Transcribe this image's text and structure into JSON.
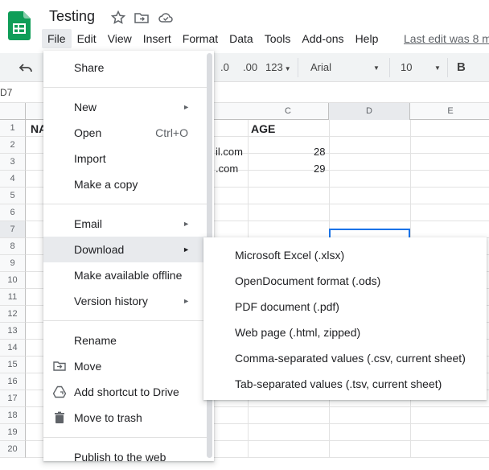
{
  "header": {
    "title": "Testing",
    "last_edit": "Last edit was 8 m",
    "menus": [
      "File",
      "Edit",
      "View",
      "Insert",
      "Format",
      "Data",
      "Tools",
      "Add-ons",
      "Help"
    ]
  },
  "toolbar": {
    "decimal_less": ".0",
    "decimal_more": ".00",
    "number_format": "123",
    "font": "Arial",
    "font_size": "10",
    "bold": "B"
  },
  "formula_bar": {
    "cell_ref": "D7"
  },
  "grid": {
    "columns": [
      "C",
      "D",
      "E"
    ],
    "rows": [
      "1",
      "2",
      "3",
      "4",
      "5",
      "6",
      "7",
      "8",
      "9",
      "10",
      "11",
      "12",
      "13",
      "14",
      "15",
      "16",
      "17",
      "18",
      "19",
      "20"
    ],
    "a1": "NA",
    "c1": "AGE",
    "b2": "il.com",
    "b3": ".com",
    "c2": "28",
    "c3": "29"
  },
  "file_menu": {
    "items": [
      {
        "label": "Share"
      },
      {
        "label": "New"
      },
      {
        "label": "Open",
        "shortcut": "Ctrl+O"
      },
      {
        "label": "Import"
      },
      {
        "label": "Make a copy"
      },
      {
        "label": "Email"
      },
      {
        "label": "Download"
      },
      {
        "label": "Make available offline"
      },
      {
        "label": "Version history"
      },
      {
        "label": "Rename"
      },
      {
        "label": "Move"
      },
      {
        "label": "Add shortcut to Drive"
      },
      {
        "label": "Move to trash"
      },
      {
        "label": "Publish to the web"
      }
    ]
  },
  "download_menu": {
    "items": [
      "Microsoft Excel (.xlsx)",
      "OpenDocument format (.ods)",
      "PDF document (.pdf)",
      "Web page (.html, zipped)",
      "Comma-separated values (.csv, current sheet)",
      "Tab-separated values (.tsv, current sheet)"
    ]
  }
}
